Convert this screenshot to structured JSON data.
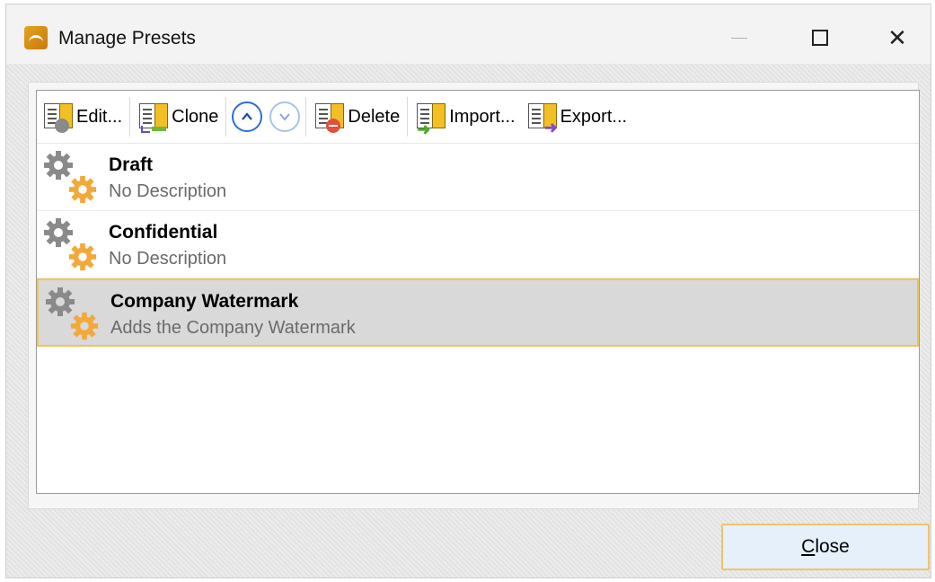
{
  "window": {
    "title": "Manage Presets"
  },
  "toolbar": {
    "edit_label": "Edit...",
    "clone_label": "Clone",
    "delete_label": "Delete",
    "import_label": "Import...",
    "export_label": "Export..."
  },
  "presets": [
    {
      "name": "Draft",
      "description": "No Description",
      "selected": false
    },
    {
      "name": "Confidential",
      "description": "No Description",
      "selected": false
    },
    {
      "name": "Company Watermark",
      "description": "Adds the Company Watermark",
      "selected": true
    }
  ],
  "footer": {
    "close_accel": "C",
    "close_rest": "lose"
  },
  "colors": {
    "selection_border": "#efc553",
    "selection_fill": "#d9d9d9",
    "gear_gray": "#8a8a8a",
    "gear_orange": "#f2a93b",
    "up_arrow": "#2a6fd6"
  }
}
